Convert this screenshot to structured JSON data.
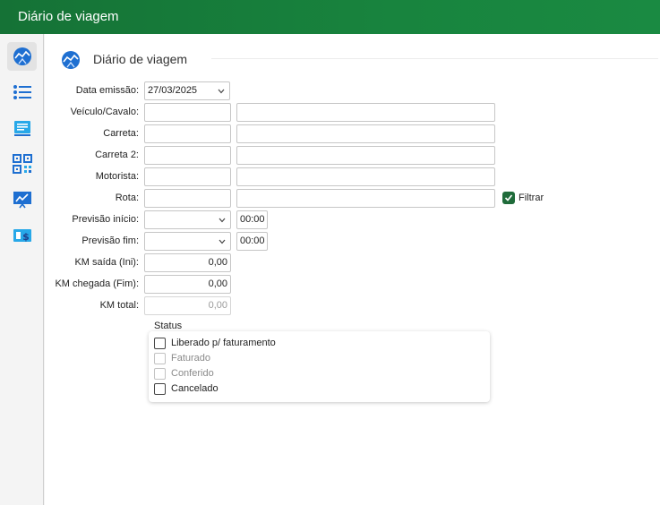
{
  "window": {
    "title": "Diário de viagem"
  },
  "sidebar": {
    "items": [
      {
        "icon": "route-icon",
        "active": true
      },
      {
        "icon": "list-icon"
      },
      {
        "icon": "document-icon"
      },
      {
        "icon": "qr-code-icon"
      },
      {
        "icon": "chart-icon"
      },
      {
        "icon": "invoice-icon"
      }
    ]
  },
  "section": {
    "title": "Diário de viagem"
  },
  "form": {
    "data_emissao": {
      "label": "Data emissão:",
      "value": "27/03/2025"
    },
    "veiculo": {
      "label": "Veículo/Cavalo:",
      "code": "",
      "desc": ""
    },
    "carreta": {
      "label": "Carreta:",
      "code": "",
      "desc": ""
    },
    "carreta2": {
      "label": "Carreta 2:",
      "code": "",
      "desc": ""
    },
    "motorista": {
      "label": "Motorista:",
      "code": "",
      "desc": ""
    },
    "rota": {
      "label": "Rota:",
      "code": "",
      "desc": ""
    },
    "filtrar": {
      "label": "Filtrar",
      "checked": true
    },
    "previsao_inicio": {
      "label": "Previsão início:",
      "date": "",
      "time": "00:00"
    },
    "previsao_fim": {
      "label": "Previsão fim:",
      "date": "",
      "time": "00:00"
    },
    "km_saida": {
      "label": "KM saída (Ini):",
      "value": "0,00"
    },
    "km_chegada": {
      "label": "KM chegada (Fim):",
      "value": "0,00"
    },
    "km_total": {
      "label": "KM total:",
      "value": "0,00"
    }
  },
  "status": {
    "title": "Status",
    "options": [
      {
        "label": "Liberado p/ faturamento",
        "enabled": true,
        "checked": false
      },
      {
        "label": "Faturado",
        "enabled": false,
        "checked": false
      },
      {
        "label": "Conferido",
        "enabled": false,
        "checked": false
      },
      {
        "label": "Cancelado",
        "enabled": true,
        "checked": false
      }
    ]
  },
  "colors": {
    "titlebar": "#18843e",
    "accent": "#1f6b3a",
    "icon_blue": "#1e6fd1"
  }
}
